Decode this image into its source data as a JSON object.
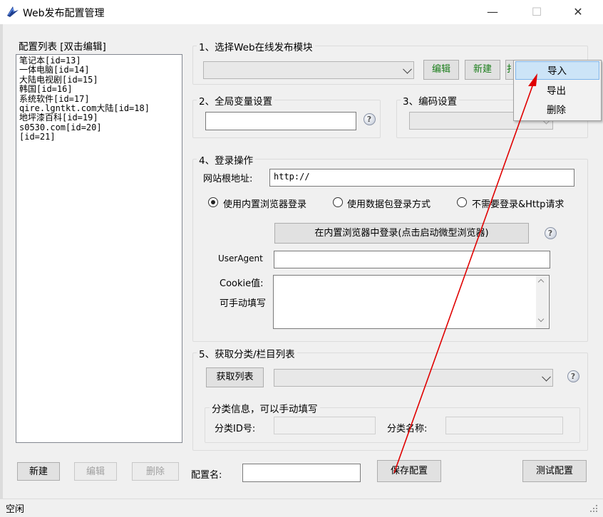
{
  "window": {
    "title": "Web发布配置管理",
    "minimize": "—",
    "maximize": "☐",
    "close": "✕"
  },
  "left": {
    "header": "配置列表 [双击编辑]",
    "items": [
      "笔记本[id=13]",
      "一体电脑[id=14]",
      "大陆电视剧[id=15]",
      "韩国[id=16]",
      "系统软件[id=17]",
      "qire.lgntkt.com大陆[id=18]",
      "地坪漆百科[id=19]",
      "s0530.com[id=20]",
      "[id=21]"
    ],
    "btn_new": "新建",
    "btn_edit": "编辑",
    "btn_delete": "删除"
  },
  "section1": {
    "title": "1、选择Web在线发布模块",
    "btn_edit": "编辑",
    "btn_new": "新建",
    "btn_partial": "扌"
  },
  "section2": {
    "title": "2、全局变量设置"
  },
  "section3": {
    "title": "3、编码设置"
  },
  "section4": {
    "title": "4、登录操作",
    "site_label": "网站根地址:",
    "site_value": "http://",
    "radio1": "使用内置浏览器登录",
    "radio2": "使用数据包登录方式",
    "radio3": "不需要登录&Http请求",
    "login_button": "在内置浏览器中登录(点击启动微型浏览器)",
    "ua_label": "UserAgent",
    "cookie_label": "Cookie值:",
    "manual_label": "可手动填写"
  },
  "section5": {
    "title": "5、获取分类/栏目列表",
    "fetch_button": "获取列表",
    "sub_title": "分类信息，可以手动填写",
    "id_label": "分类ID号:",
    "name_label": "分类名称:"
  },
  "bottom": {
    "config_name_label": "配置名:",
    "save": "保存配置",
    "test": "测试配置"
  },
  "menu": {
    "import": "导入",
    "export": "导出",
    "delete": "删除"
  },
  "status": {
    "text": "空闲"
  },
  "colors": {
    "annotation_red": "#e00000",
    "highlight": "#cce4f7"
  },
  "help_glyph": "?"
}
